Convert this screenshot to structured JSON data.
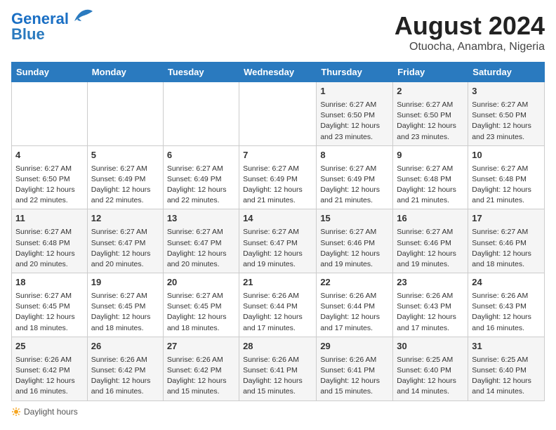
{
  "logo": {
    "line1": "General",
    "line2": "Blue"
  },
  "title": "August 2024",
  "subtitle": "Otuocha, Anambra, Nigeria",
  "days_header": [
    "Sunday",
    "Monday",
    "Tuesday",
    "Wednesday",
    "Thursday",
    "Friday",
    "Saturday"
  ],
  "weeks": [
    [
      {
        "num": "",
        "info": ""
      },
      {
        "num": "",
        "info": ""
      },
      {
        "num": "",
        "info": ""
      },
      {
        "num": "",
        "info": ""
      },
      {
        "num": "1",
        "info": "Sunrise: 6:27 AM\nSunset: 6:50 PM\nDaylight: 12 hours\nand 23 minutes."
      },
      {
        "num": "2",
        "info": "Sunrise: 6:27 AM\nSunset: 6:50 PM\nDaylight: 12 hours\nand 23 minutes."
      },
      {
        "num": "3",
        "info": "Sunrise: 6:27 AM\nSunset: 6:50 PM\nDaylight: 12 hours\nand 23 minutes."
      }
    ],
    [
      {
        "num": "4",
        "info": "Sunrise: 6:27 AM\nSunset: 6:50 PM\nDaylight: 12 hours\nand 22 minutes."
      },
      {
        "num": "5",
        "info": "Sunrise: 6:27 AM\nSunset: 6:49 PM\nDaylight: 12 hours\nand 22 minutes."
      },
      {
        "num": "6",
        "info": "Sunrise: 6:27 AM\nSunset: 6:49 PM\nDaylight: 12 hours\nand 22 minutes."
      },
      {
        "num": "7",
        "info": "Sunrise: 6:27 AM\nSunset: 6:49 PM\nDaylight: 12 hours\nand 21 minutes."
      },
      {
        "num": "8",
        "info": "Sunrise: 6:27 AM\nSunset: 6:49 PM\nDaylight: 12 hours\nand 21 minutes."
      },
      {
        "num": "9",
        "info": "Sunrise: 6:27 AM\nSunset: 6:48 PM\nDaylight: 12 hours\nand 21 minutes."
      },
      {
        "num": "10",
        "info": "Sunrise: 6:27 AM\nSunset: 6:48 PM\nDaylight: 12 hours\nand 21 minutes."
      }
    ],
    [
      {
        "num": "11",
        "info": "Sunrise: 6:27 AM\nSunset: 6:48 PM\nDaylight: 12 hours\nand 20 minutes."
      },
      {
        "num": "12",
        "info": "Sunrise: 6:27 AM\nSunset: 6:47 PM\nDaylight: 12 hours\nand 20 minutes."
      },
      {
        "num": "13",
        "info": "Sunrise: 6:27 AM\nSunset: 6:47 PM\nDaylight: 12 hours\nand 20 minutes."
      },
      {
        "num": "14",
        "info": "Sunrise: 6:27 AM\nSunset: 6:47 PM\nDaylight: 12 hours\nand 19 minutes."
      },
      {
        "num": "15",
        "info": "Sunrise: 6:27 AM\nSunset: 6:46 PM\nDaylight: 12 hours\nand 19 minutes."
      },
      {
        "num": "16",
        "info": "Sunrise: 6:27 AM\nSunset: 6:46 PM\nDaylight: 12 hours\nand 19 minutes."
      },
      {
        "num": "17",
        "info": "Sunrise: 6:27 AM\nSunset: 6:46 PM\nDaylight: 12 hours\nand 18 minutes."
      }
    ],
    [
      {
        "num": "18",
        "info": "Sunrise: 6:27 AM\nSunset: 6:45 PM\nDaylight: 12 hours\nand 18 minutes."
      },
      {
        "num": "19",
        "info": "Sunrise: 6:27 AM\nSunset: 6:45 PM\nDaylight: 12 hours\nand 18 minutes."
      },
      {
        "num": "20",
        "info": "Sunrise: 6:27 AM\nSunset: 6:45 PM\nDaylight: 12 hours\nand 18 minutes."
      },
      {
        "num": "21",
        "info": "Sunrise: 6:26 AM\nSunset: 6:44 PM\nDaylight: 12 hours\nand 17 minutes."
      },
      {
        "num": "22",
        "info": "Sunrise: 6:26 AM\nSunset: 6:44 PM\nDaylight: 12 hours\nand 17 minutes."
      },
      {
        "num": "23",
        "info": "Sunrise: 6:26 AM\nSunset: 6:43 PM\nDaylight: 12 hours\nand 17 minutes."
      },
      {
        "num": "24",
        "info": "Sunrise: 6:26 AM\nSunset: 6:43 PM\nDaylight: 12 hours\nand 16 minutes."
      }
    ],
    [
      {
        "num": "25",
        "info": "Sunrise: 6:26 AM\nSunset: 6:42 PM\nDaylight: 12 hours\nand 16 minutes."
      },
      {
        "num": "26",
        "info": "Sunrise: 6:26 AM\nSunset: 6:42 PM\nDaylight: 12 hours\nand 16 minutes."
      },
      {
        "num": "27",
        "info": "Sunrise: 6:26 AM\nSunset: 6:42 PM\nDaylight: 12 hours\nand 15 minutes."
      },
      {
        "num": "28",
        "info": "Sunrise: 6:26 AM\nSunset: 6:41 PM\nDaylight: 12 hours\nand 15 minutes."
      },
      {
        "num": "29",
        "info": "Sunrise: 6:26 AM\nSunset: 6:41 PM\nDaylight: 12 hours\nand 15 minutes."
      },
      {
        "num": "30",
        "info": "Sunrise: 6:25 AM\nSunset: 6:40 PM\nDaylight: 12 hours\nand 14 minutes."
      },
      {
        "num": "31",
        "info": "Sunrise: 6:25 AM\nSunset: 6:40 PM\nDaylight: 12 hours\nand 14 minutes."
      }
    ]
  ],
  "footer": {
    "daylight_label": "Daylight hours"
  }
}
